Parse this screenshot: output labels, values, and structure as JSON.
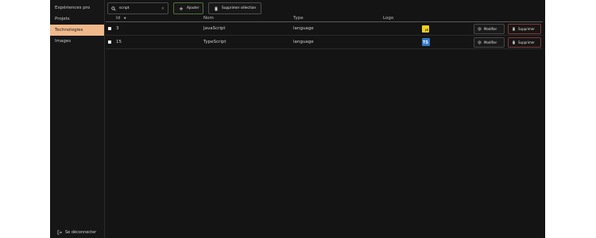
{
  "sidebar": {
    "items": [
      {
        "label": "Expériences pro"
      },
      {
        "label": "Projets"
      },
      {
        "label": "Technologies"
      },
      {
        "label": "Images"
      }
    ],
    "active_index": 2,
    "logout_label": "Se déconnecter"
  },
  "toolbar": {
    "search_value": "script",
    "add_label": "Ajouter",
    "delete_selection_label": "Supprimer sélection"
  },
  "table": {
    "columns": [
      {
        "label": "Id",
        "sort": "desc"
      },
      {
        "label": "Nom"
      },
      {
        "label": "Type"
      },
      {
        "label": "Logo"
      }
    ],
    "rows": [
      {
        "id": "3",
        "name": "JavaScript",
        "type": "language",
        "logo": {
          "icon": "javascript-logo",
          "text": "JS",
          "color": "#f0d21e"
        }
      },
      {
        "id": "15",
        "name": "TypeScript",
        "type": "language",
        "logo": {
          "icon": "typescript-logo",
          "text": "TS",
          "color": "#3178c6"
        }
      }
    ],
    "edit_label": "Modifier",
    "delete_label": "Supprimer"
  },
  "colors": {
    "accent": "#f0b98b",
    "background": "#141414",
    "add_border": "#4f6f3e",
    "delete_border": "#7a3a3a"
  }
}
